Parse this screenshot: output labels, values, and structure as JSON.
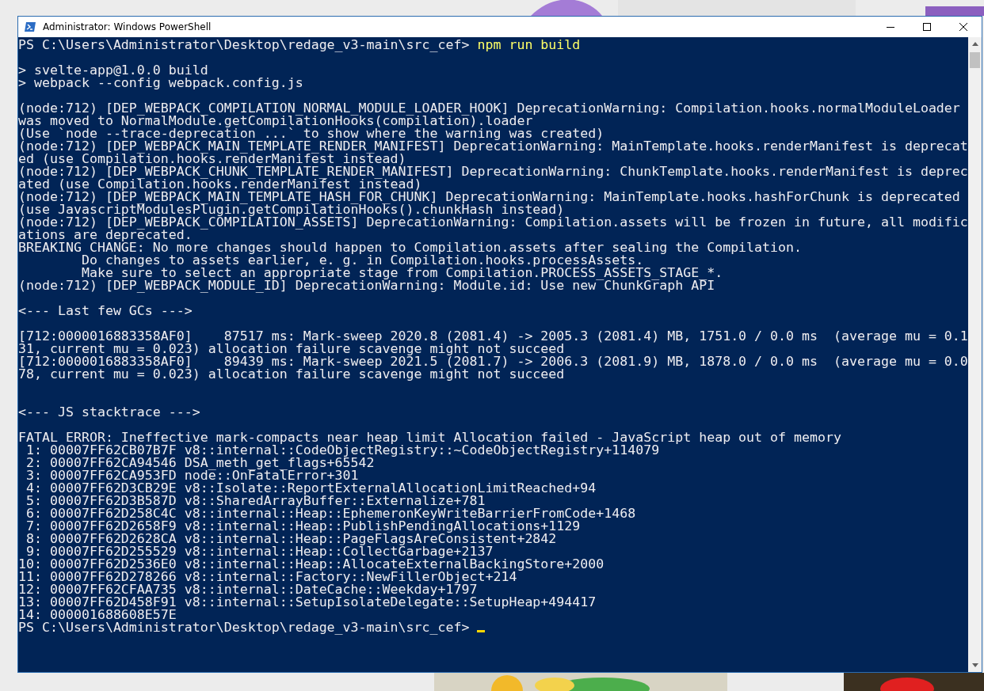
{
  "window": {
    "title": "Administrator: Windows PowerShell"
  },
  "console": {
    "lines": [
      {
        "kind": "prompt",
        "prompt": "PS C:\\Users\\Administrator\\Desktop\\redage_v3-main\\src_cef> ",
        "command": "npm run build",
        "cursor": false
      },
      {
        "kind": "blank"
      },
      {
        "kind": "text",
        "text": "> svelte-app@1.0.0 build"
      },
      {
        "kind": "text",
        "text": "> webpack --config webpack.config.js"
      },
      {
        "kind": "blank"
      },
      {
        "kind": "text",
        "text": "(node:712) [DEP_WEBPACK_COMPILATION_NORMAL_MODULE_LOADER_HOOK] DeprecationWarning: Compilation.hooks.normalModuleLoader"
      },
      {
        "kind": "text",
        "text": "was moved to NormalModule.getCompilationHooks(compilation).loader"
      },
      {
        "kind": "text",
        "text": "(Use `node --trace-deprecation ...` to show where the warning was created)"
      },
      {
        "kind": "text",
        "text": "(node:712) [DEP_WEBPACK_MAIN_TEMPLATE_RENDER_MANIFEST] DeprecationWarning: MainTemplate.hooks.renderManifest is deprecat"
      },
      {
        "kind": "text",
        "text": "ed (use Compilation.hooks.renderManifest instead)"
      },
      {
        "kind": "text",
        "text": "(node:712) [DEP_WEBPACK_CHUNK_TEMPLATE_RENDER_MANIFEST] DeprecationWarning: ChunkTemplate.hooks.renderManifest is deprec"
      },
      {
        "kind": "text",
        "text": "ated (use Compilation.hooks.renderManifest instead)"
      },
      {
        "kind": "text",
        "text": "(node:712) [DEP_WEBPACK_MAIN_TEMPLATE_HASH_FOR_CHUNK] DeprecationWarning: MainTemplate.hooks.hashForChunk is deprecated"
      },
      {
        "kind": "text",
        "text": "(use JavascriptModulesPlugin.getCompilationHooks().chunkHash instead)"
      },
      {
        "kind": "text",
        "text": "(node:712) [DEP_WEBPACK_COMPILATION_ASSETS] DeprecationWarning: Compilation.assets will be frozen in future, all modific"
      },
      {
        "kind": "text",
        "text": "ations are deprecated."
      },
      {
        "kind": "text",
        "text": "BREAKING CHANGE: No more changes should happen to Compilation.assets after sealing the Compilation."
      },
      {
        "kind": "text",
        "text": "        Do changes to assets earlier, e. g. in Compilation.hooks.processAssets."
      },
      {
        "kind": "text",
        "text": "        Make sure to select an appropriate stage from Compilation.PROCESS_ASSETS_STAGE_*."
      },
      {
        "kind": "text",
        "text": "(node:712) [DEP_WEBPACK_MODULE_ID] DeprecationWarning: Module.id: Use new ChunkGraph API"
      },
      {
        "kind": "blank"
      },
      {
        "kind": "text",
        "text": "<--- Last few GCs --->"
      },
      {
        "kind": "blank"
      },
      {
        "kind": "text",
        "text": "[712:0000016883358AF0]    87517 ms: Mark-sweep 2020.8 (2081.4) -> 2005.3 (2081.4) MB, 1751.0 / 0.0 ms  (average mu = 0.1"
      },
      {
        "kind": "text",
        "text": "31, current mu = 0.023) allocation failure scavenge might not succeed"
      },
      {
        "kind": "text",
        "text": "[712:0000016883358AF0]    89439 ms: Mark-sweep 2021.5 (2081.7) -> 2006.3 (2081.9) MB, 1878.0 / 0.0 ms  (average mu = 0.0"
      },
      {
        "kind": "text",
        "text": "78, current mu = 0.023) allocation failure scavenge might not succeed"
      },
      {
        "kind": "blank"
      },
      {
        "kind": "blank"
      },
      {
        "kind": "text",
        "text": "<--- JS stacktrace --->"
      },
      {
        "kind": "blank"
      },
      {
        "kind": "text",
        "text": "FATAL ERROR: Ineffective mark-compacts near heap limit Allocation failed - JavaScript heap out of memory"
      },
      {
        "kind": "text",
        "text": " 1: 00007FF62CB07B7F v8::internal::CodeObjectRegistry::~CodeObjectRegistry+114079"
      },
      {
        "kind": "text",
        "text": " 2: 00007FF62CA94546 DSA_meth_get_flags+65542"
      },
      {
        "kind": "text",
        "text": " 3: 00007FF62CA953FD node::OnFatalError+301"
      },
      {
        "kind": "text",
        "text": " 4: 00007FF62D3CB29E v8::Isolate::ReportExternalAllocationLimitReached+94"
      },
      {
        "kind": "text",
        "text": " 5: 00007FF62D3B587D v8::SharedArrayBuffer::Externalize+781"
      },
      {
        "kind": "text",
        "text": " 6: 00007FF62D258C4C v8::internal::Heap::EphemeronKeyWriteBarrierFromCode+1468"
      },
      {
        "kind": "text",
        "text": " 7: 00007FF62D2658F9 v8::internal::Heap::PublishPendingAllocations+1129"
      },
      {
        "kind": "text",
        "text": " 8: 00007FF62D2628CA v8::internal::Heap::PageFlagsAreConsistent+2842"
      },
      {
        "kind": "text",
        "text": " 9: 00007FF62D255529 v8::internal::Heap::CollectGarbage+2137"
      },
      {
        "kind": "text",
        "text": "10: 00007FF62D2536E0 v8::internal::Heap::AllocateExternalBackingStore+2000"
      },
      {
        "kind": "text",
        "text": "11: 00007FF62D278266 v8::internal::Factory::NewFillerObject+214"
      },
      {
        "kind": "text",
        "text": "12: 00007FF62CFAA735 v8::internal::DateCache::Weekday+1797"
      },
      {
        "kind": "text",
        "text": "13: 00007FF62D458F91 v8::internal::SetupIsolateDelegate::SetupHeap+494417"
      },
      {
        "kind": "text",
        "text": "14: 000001688608E57E"
      },
      {
        "kind": "prompt",
        "prompt": "PS C:\\Users\\Administrator\\Desktop\\redage_v3-main\\src_cef> ",
        "cursor": true
      }
    ]
  }
}
